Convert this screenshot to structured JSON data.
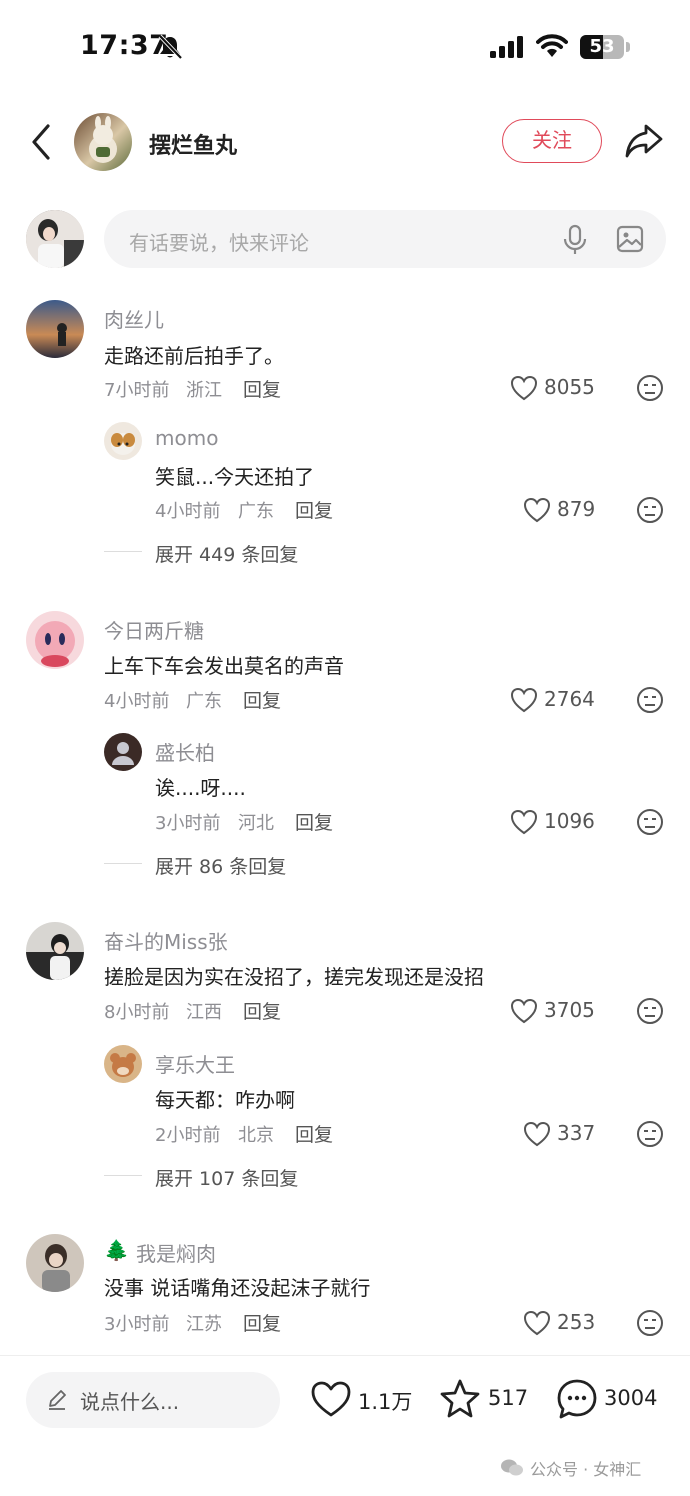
{
  "status_bar": {
    "time": "17:37",
    "battery": "53",
    "battery_level": 0.53
  },
  "header": {
    "author_name": "摆烂鱼丸",
    "follow_label": "关注"
  },
  "comment_input": {
    "placeholder": "有话要说，快来评论"
  },
  "comments": [
    {
      "user": "肉丝儿",
      "text": "走路还前后拍手了。",
      "time": "7小时前",
      "region": "浙江",
      "reply": "回复",
      "likes": "8055",
      "sub": {
        "user": "momo",
        "text": "笑鼠...今天还拍了",
        "time": "4小时前",
        "region": "广东",
        "reply": "回复",
        "likes": "879"
      },
      "expand": "展开 449 条回复"
    },
    {
      "user": "今日两斤糖",
      "text": "上车下车会发出莫名的声音",
      "time": "4小时前",
      "region": "广东",
      "reply": "回复",
      "likes": "2764",
      "sub": {
        "user": "盛长柏",
        "text": "诶....呀....",
        "time": "3小时前",
        "region": "河北",
        "reply": "回复",
        "likes": "1096"
      },
      "expand": "展开 86 条回复"
    },
    {
      "user": "奋斗的Miss张",
      "text": "搓脸是因为实在没招了，搓完发现还是没招",
      "time": "8小时前",
      "region": "江西",
      "reply": "回复",
      "likes": "3705",
      "sub": {
        "user": "享乐大王",
        "text": "每天都：咋办啊",
        "time": "2小时前",
        "region": "北京",
        "reply": "回复",
        "likes": "337"
      },
      "expand": "展开 107 条回复"
    },
    {
      "user": "我是焖肉",
      "user_prefix": "🌲",
      "text": "没事 说话嘴角还没起沫子就行",
      "time": "3小时前",
      "region": "江苏",
      "reply": "回复",
      "likes": "253"
    }
  ],
  "bottom_bar": {
    "input_placeholder": "说点什么...",
    "likes": "1.1万",
    "favorites": "517",
    "comments": "3004"
  },
  "watermark": "公众号 · 女神汇",
  "icons": {
    "status": [
      "bell-off-icon",
      "signal-icon",
      "wifi-icon"
    ],
    "header": [
      "back-icon",
      "share-icon"
    ],
    "input": [
      "mic-icon",
      "image-icon",
      "pencil-icon"
    ],
    "comment": [
      "heart-icon",
      "dislike-face-icon"
    ],
    "bottom": [
      "heart-icon",
      "star-icon",
      "chat-icon",
      "wechat-icon"
    ]
  },
  "colors": {
    "accent": "#e04a5a",
    "meta_gray": "#8e8e93",
    "input_bg": "#f4f4f5"
  }
}
